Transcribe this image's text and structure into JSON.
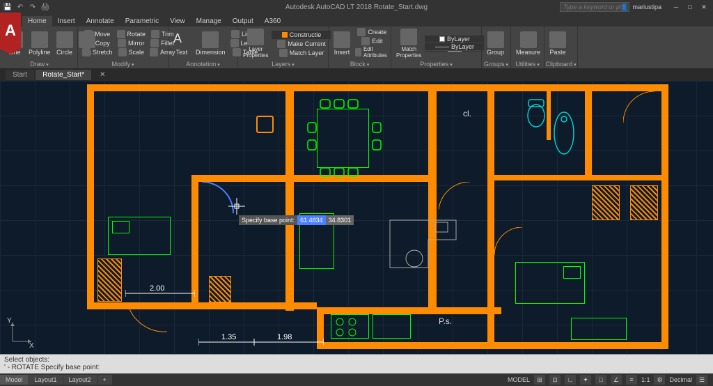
{
  "app": {
    "title": "Autodesk AutoCAD LT 2018   Rotate_Start.dwg",
    "search_placeholder": "Type a keyword or phrase",
    "user": "mariustipa"
  },
  "tabs": [
    "Home",
    "Insert",
    "Annotate",
    "Parametric",
    "View",
    "Manage",
    "Output",
    "A360"
  ],
  "active_tab": 0,
  "ribbon": {
    "draw": {
      "title": "Draw",
      "items": [
        "Line",
        "Polyline",
        "Circle",
        "Arc"
      ]
    },
    "modify": {
      "title": "Modify",
      "items": [
        "Move",
        "Copy",
        "Stretch",
        "Rotate",
        "Mirror",
        "Scale",
        "Trim",
        "Fillet",
        "Array"
      ]
    },
    "annotation": {
      "title": "Annotation",
      "items": [
        "Text",
        "Dimension",
        "Linear",
        "Leader",
        "Table"
      ]
    },
    "layers": {
      "title": "Layers",
      "items": [
        "Layer Properties",
        "Constructie",
        "Make Current",
        "Match Layer"
      ],
      "dropdown": "Constructie"
    },
    "block": {
      "title": "Block",
      "items": [
        "Insert",
        "Create",
        "Edit",
        "Edit Attributes"
      ]
    },
    "properties": {
      "title": "Properties",
      "items": [
        "Match Properties",
        "ByLayer",
        "ByLayer"
      ]
    },
    "groups": {
      "title": "Groups",
      "items": [
        "Group"
      ]
    },
    "utilities": {
      "title": "Utilities",
      "items": [
        "Measure"
      ]
    },
    "clipboard": {
      "title": "Clipboard",
      "items": [
        "Paste"
      ]
    }
  },
  "filetabs": [
    "Start",
    "Rotate_Start*"
  ],
  "active_filetab": 1,
  "canvas": {
    "tooltip": {
      "label": "Specify base point:",
      "val1": "61.4834",
      "val2": "34.8301"
    },
    "dims": {
      "d1": "2.00",
      "d2": "1.35",
      "d3": "1.98"
    },
    "labels": {
      "cl": "cl.",
      "ps": "P.s."
    },
    "ucs": {
      "x": "X",
      "y": "Y"
    }
  },
  "cmdline": {
    "l1": "Select objects:",
    "l2": "' - ROTATE Specify base point:"
  },
  "status": {
    "tabs": [
      "Model",
      "Layout1",
      "Layout2"
    ],
    "active": 0,
    "mode": "MODEL",
    "scale": "1:1",
    "decimal": "Decimal"
  }
}
